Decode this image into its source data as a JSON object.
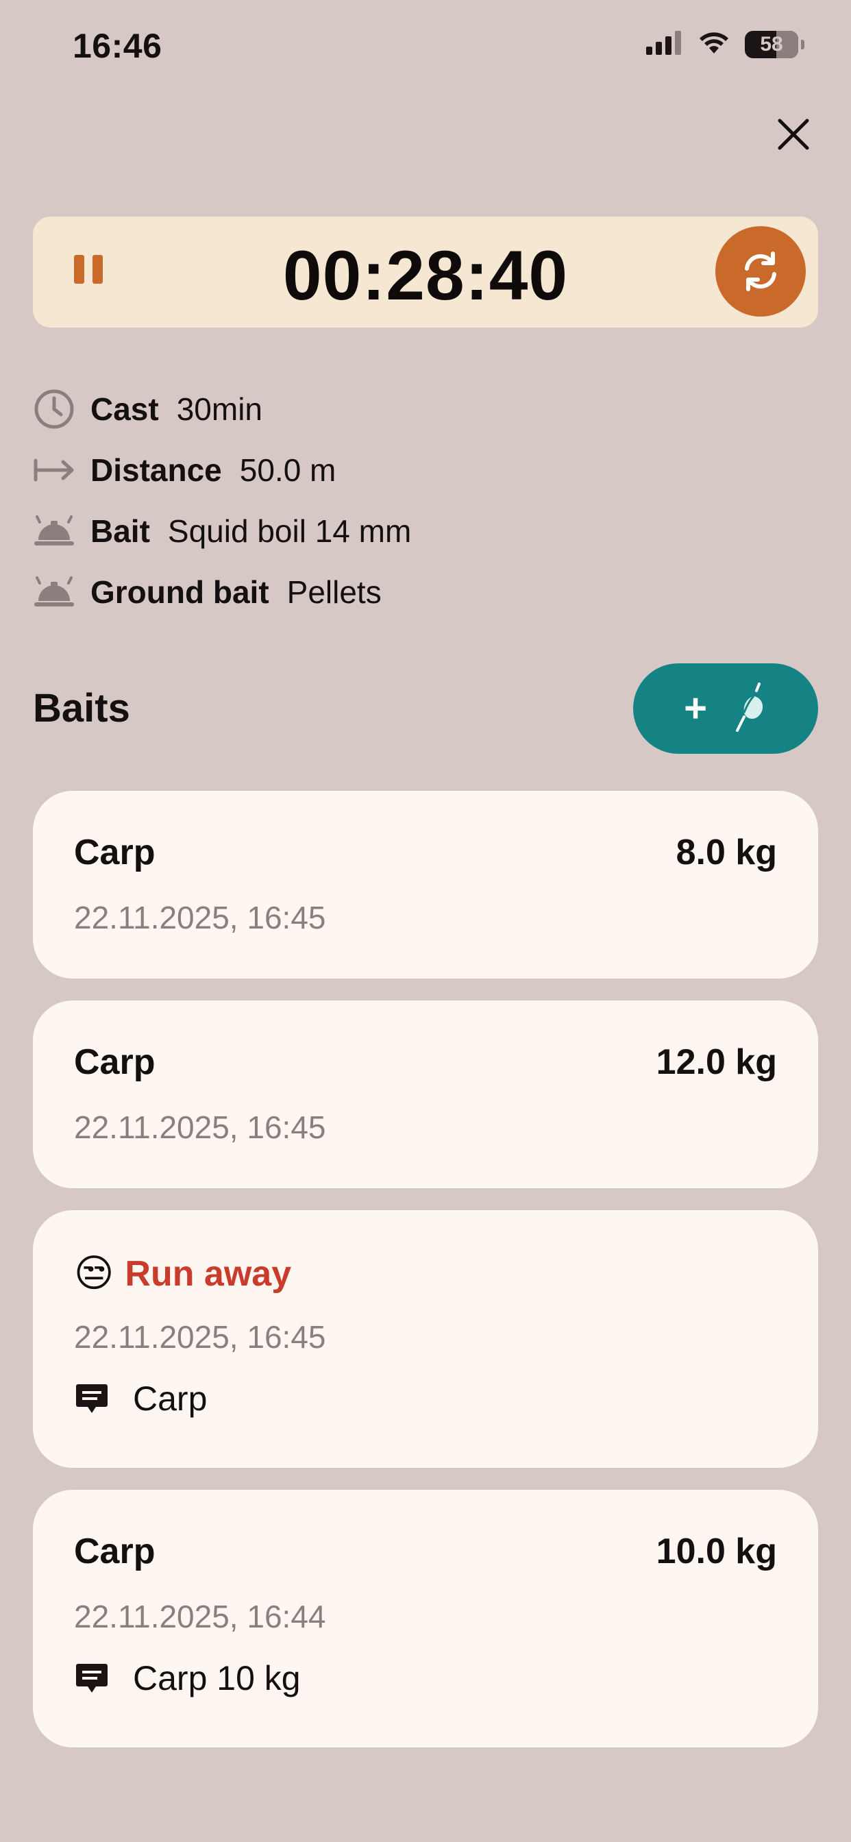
{
  "status_bar": {
    "time": "16:46",
    "battery": "58",
    "icons": [
      "signal-icon",
      "wifi-icon",
      "battery-icon"
    ]
  },
  "header": {
    "close_icon": "close-icon"
  },
  "timer": {
    "value": "00:28:40",
    "pause_icon": "pause-icon",
    "reset_icon": "refresh-icon",
    "accent_color": "#c96a2b",
    "background": "#f5e7d2"
  },
  "details": [
    {
      "icon": "clock-icon",
      "label": "Cast",
      "value": "30min"
    },
    {
      "icon": "arrow-right-to-icon",
      "label": "Distance",
      "value": "50.0 m"
    },
    {
      "icon": "bell-tray-icon",
      "label": "Bait",
      "value": "Squid boil 14 mm"
    },
    {
      "icon": "bell-tray-icon",
      "label": "Ground bait",
      "value": "Pellets"
    }
  ],
  "baits": {
    "title": "Baits",
    "add_button": {
      "plus": "+",
      "icon": "fishing-float-icon",
      "color": "#158383"
    }
  },
  "entries": [
    {
      "type": "catch",
      "title": "Carp",
      "weight": "8.0 kg",
      "date": "22.11.2025, 16:45"
    },
    {
      "type": "catch",
      "title": "Carp",
      "weight": "12.0 kg",
      "date": "22.11.2025, 16:45"
    },
    {
      "type": "runaway",
      "emoji": "😒",
      "title": "Run away",
      "date": "22.11.2025, 16:45",
      "note": "Carp",
      "color": "#c83c2c"
    },
    {
      "type": "catch",
      "title": "Carp",
      "weight": "10.0 kg",
      "date": "22.11.2025, 16:44",
      "note": "Carp 10 kg"
    }
  ]
}
